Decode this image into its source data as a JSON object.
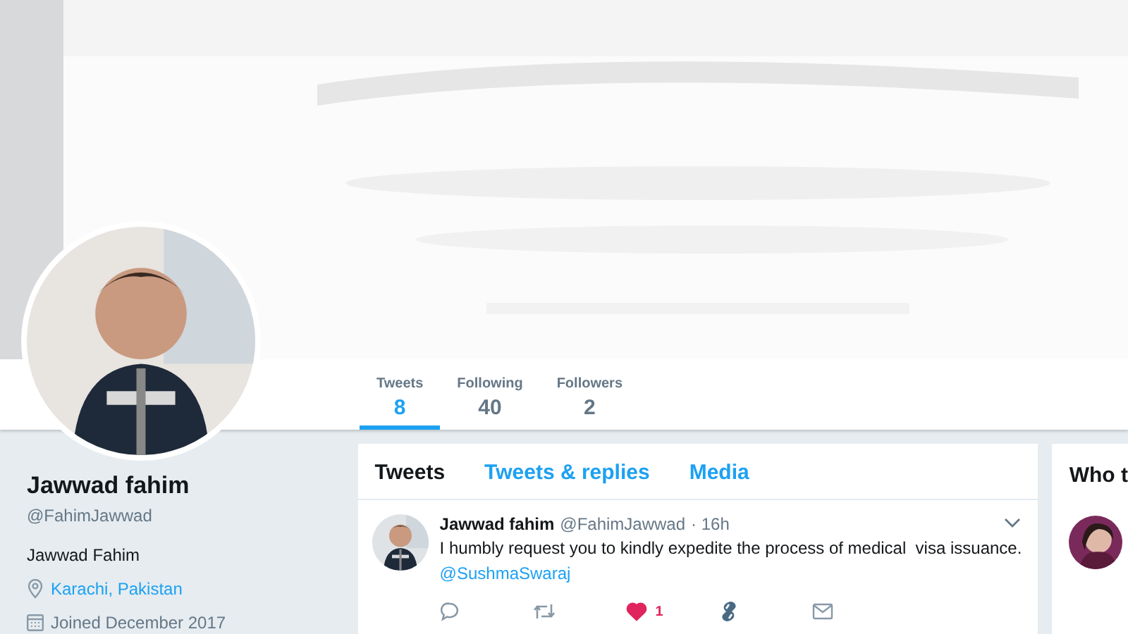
{
  "stats": [
    {
      "label": "Tweets",
      "value": "8",
      "selected": true
    },
    {
      "label": "Following",
      "value": "40",
      "selected": false
    },
    {
      "label": "Followers",
      "value": "2",
      "selected": false
    }
  ],
  "profile": {
    "name": "Jawwad fahim",
    "handle": "@FahimJawwad",
    "bio": "Jawwad Fahim",
    "location": "Karachi, Pakistan",
    "joined": "Joined December 2017"
  },
  "timeline_tabs": [
    {
      "label": "Tweets",
      "selected": true
    },
    {
      "label": "Tweets & replies",
      "selected": false
    },
    {
      "label": "Media",
      "selected": false
    }
  ],
  "tweets": [
    {
      "name": "Jawwad fahim",
      "handle": "@FahimJawwad",
      "time": "· 16h",
      "text": "I humbly request you to kindly expedite the process of medical  visa issuance.",
      "mention": "@SushmaSwaraj",
      "actions": [
        {
          "kind": "reply"
        },
        {
          "kind": "retweet"
        },
        {
          "kind": "like",
          "liked": true,
          "count": "1"
        },
        {
          "kind": "app"
        },
        {
          "kind": "message"
        }
      ]
    }
  ],
  "who_to_follow": {
    "title": "Who t"
  }
}
